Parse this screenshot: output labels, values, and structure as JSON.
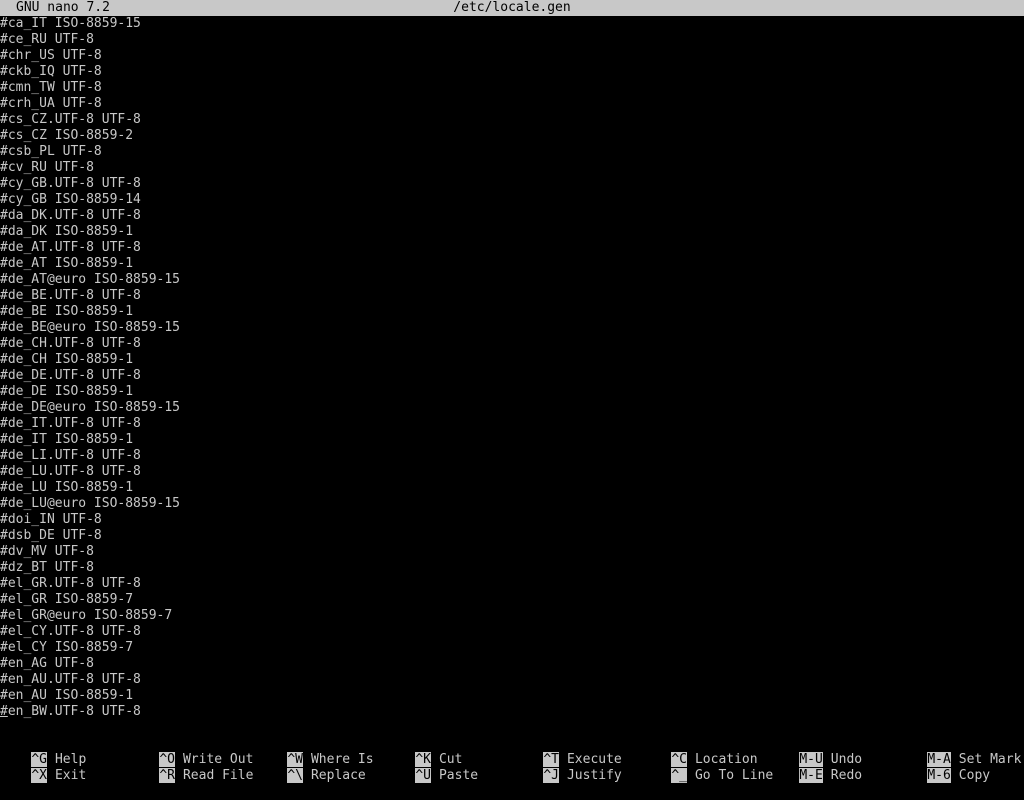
{
  "title": {
    "app_version": "GNU nano 7.2",
    "filename": "/etc/locale.gen"
  },
  "lines": [
    "#ca_IT ISO-8859-15",
    "#ce_RU UTF-8",
    "#chr_US UTF-8",
    "#ckb_IQ UTF-8",
    "#cmn_TW UTF-8",
    "#crh_UA UTF-8",
    "#cs_CZ.UTF-8 UTF-8",
    "#cs_CZ ISO-8859-2",
    "#csb_PL UTF-8",
    "#cv_RU UTF-8",
    "#cy_GB.UTF-8 UTF-8",
    "#cy_GB ISO-8859-14",
    "#da_DK.UTF-8 UTF-8",
    "#da_DK ISO-8859-1",
    "#de_AT.UTF-8 UTF-8",
    "#de_AT ISO-8859-1",
    "#de_AT@euro ISO-8859-15",
    "#de_BE.UTF-8 UTF-8",
    "#de_BE ISO-8859-1",
    "#de_BE@euro ISO-8859-15",
    "#de_CH.UTF-8 UTF-8",
    "#de_CH ISO-8859-1",
    "#de_DE.UTF-8 UTF-8",
    "#de_DE ISO-8859-1",
    "#de_DE@euro ISO-8859-15",
    "#de_IT.UTF-8 UTF-8",
    "#de_IT ISO-8859-1",
    "#de_LI.UTF-8 UTF-8",
    "#de_LU.UTF-8 UTF-8",
    "#de_LU ISO-8859-1",
    "#de_LU@euro ISO-8859-15",
    "#doi_IN UTF-8",
    "#dsb_DE UTF-8",
    "#dv_MV UTF-8",
    "#dz_BT UTF-8",
    "#el_GR.UTF-8 UTF-8",
    "#el_GR ISO-8859-7",
    "#el_GR@euro ISO-8859-7",
    "#el_CY.UTF-8 UTF-8",
    "#el_CY ISO-8859-7",
    "#en_AG UTF-8",
    "#en_AU.UTF-8 UTF-8",
    "#en_AU ISO-8859-1",
    "#en_BW.UTF-8 UTF-8"
  ],
  "shortcuts": {
    "help": {
      "key": "^G",
      "label": "Help"
    },
    "exit": {
      "key": "^X",
      "label": "Exit"
    },
    "write_out": {
      "key": "^O",
      "label": "Write Out"
    },
    "read_file": {
      "key": "^R",
      "label": "Read File"
    },
    "where_is": {
      "key": "^W",
      "label": "Where Is"
    },
    "replace": {
      "key": "^\\",
      "label": "Replace"
    },
    "cut": {
      "key": "^K",
      "label": "Cut"
    },
    "paste": {
      "key": "^U",
      "label": "Paste"
    },
    "execute": {
      "key": "^T",
      "label": "Execute"
    },
    "justify": {
      "key": "^J",
      "label": "Justify"
    },
    "location": {
      "key": "^C",
      "label": "Location"
    },
    "go_to_line": {
      "key": "^_",
      "label": "Go To Line"
    },
    "undo": {
      "key": "M-U",
      "label": "Undo"
    },
    "redo": {
      "key": "M-E",
      "label": "Redo"
    },
    "set_mark": {
      "key": "M-A",
      "label": "Set Mark"
    },
    "copy": {
      "key": "M-6",
      "label": "Copy"
    }
  },
  "colors": {
    "background": "#000000",
    "foreground": "#c8c8c8",
    "titlebar_bg": "#c8c8c8",
    "titlebar_fg": "#000000"
  }
}
